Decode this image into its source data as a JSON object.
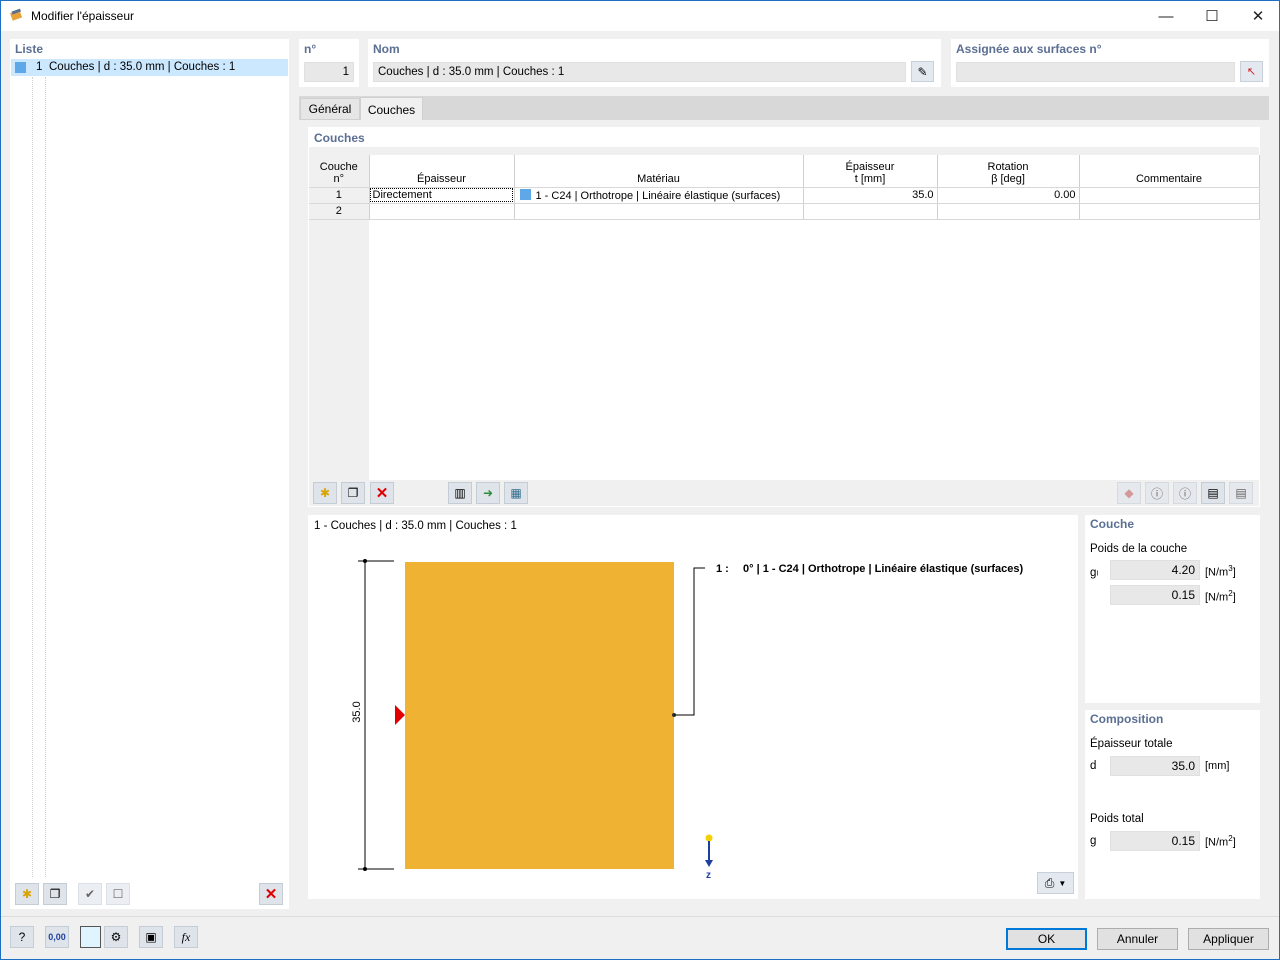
{
  "window": {
    "title": "Modifier l'épaisseur",
    "minimize": "—",
    "maximize": "☐",
    "close": "✕"
  },
  "list": {
    "header": "Liste",
    "items": [
      {
        "number": "1",
        "label": "Couches | d : 35.0 mm | Couches : 1",
        "color": "#5fa8e8"
      }
    ]
  },
  "number_section": {
    "header": "n°",
    "value": "1"
  },
  "name_section": {
    "header": "Nom",
    "value": "Couches | d : 35.0 mm | Couches : 1"
  },
  "assigned_section": {
    "header": "Assignée aux surfaces n°",
    "value": ""
  },
  "tabs": [
    {
      "label": "Général",
      "active": false
    },
    {
      "label": "Couches",
      "active": true
    }
  ],
  "layers": {
    "header": "Couches",
    "columns": {
      "layer_no": [
        "Couche",
        "n°"
      ],
      "thickness_type": [
        "",
        "Épaisseur"
      ],
      "material": [
        "",
        "Matériau"
      ],
      "thickness": [
        "Épaisseur",
        "t [mm]"
      ],
      "rotation": [
        "Rotation",
        "β [deg]"
      ],
      "comment": [
        "",
        "Commentaire"
      ]
    },
    "rows": [
      {
        "no": "1",
        "thickness_type": "Directement",
        "material": "1 - C24 | Orthotrope | Linéaire élastique (surfaces)",
        "material_color": "#5fa8e8",
        "thickness": "35.0",
        "rotation": "0.00",
        "comment": ""
      },
      {
        "no": "2",
        "thickness_type": "",
        "material": "",
        "material_color": "",
        "thickness": "",
        "rotation": "",
        "comment": ""
      }
    ]
  },
  "preview": {
    "title": "1 - Couches | d : 35.0 mm | Couches : 1",
    "dimension_label": "35.0",
    "layer_label_no": "1 :",
    "layer_label_text": "0° | 1 - C24 | Orthotrope | Linéaire élastique (surfaces)",
    "axis_label": "z",
    "layer_fill": "#f0b232"
  },
  "couche": {
    "header": "Couche",
    "weight_label": "Poids de la couche",
    "g_symbol": "gₗ",
    "g_value": "4.20",
    "g_unit_base": "[N/m",
    "g_unit_exp": "3",
    "g2_value": "0.15",
    "g2_unit_base": "[N/m",
    "g2_unit_exp": "2"
  },
  "composition": {
    "header": "Composition",
    "total_thickness_label": "Épaisseur totale",
    "d_symbol": "d",
    "d_value": "35.0",
    "d_unit": "[mm]",
    "total_weight_label": "Poids total",
    "g_symbol": "g",
    "g_value": "0.15",
    "g_unit_base": "[N/m",
    "g_unit_exp": "2"
  },
  "footer": {
    "ok": "OK",
    "cancel": "Annuler",
    "apply": "Appliquer"
  }
}
